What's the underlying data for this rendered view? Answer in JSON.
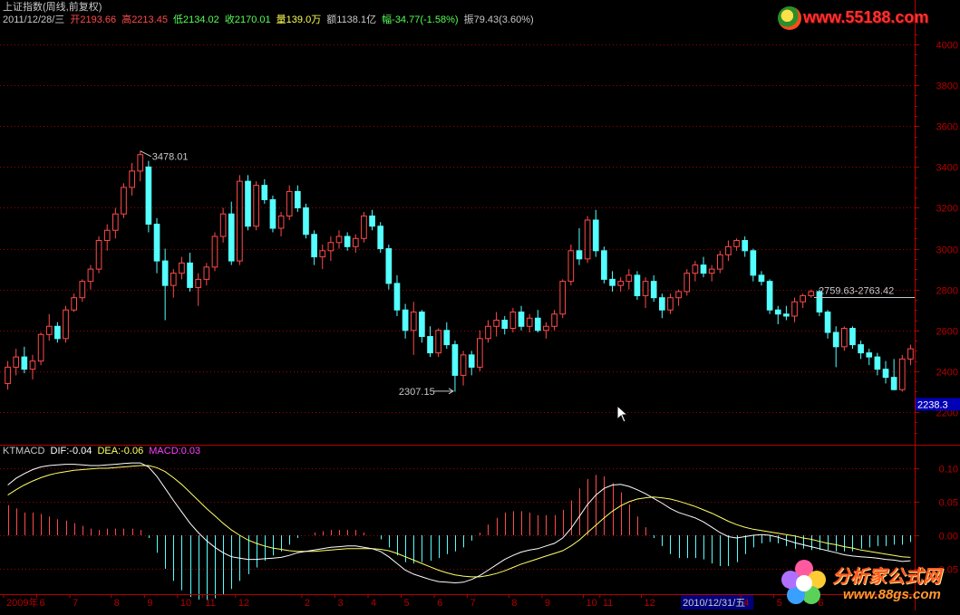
{
  "colors": {
    "background": "#000000",
    "axis": "#b40000",
    "grid": "#a00000",
    "up": "#ff4a4a",
    "down": "#54ffff",
    "label_white": "#c8c8c8",
    "dif_line": "#ffffff",
    "dea_line": "#ffff66",
    "macd_label": "#ff40ff",
    "last_price_bg": "#0000b4",
    "date_highlight_bg": "#00007a"
  },
  "header": {
    "title": "上证指数(周线,前复权)",
    "date": "2011/12/28/三",
    "open_label": "开",
    "open": "2193.66",
    "high_label": "高",
    "high": "2213.45",
    "low_label": "低",
    "low": "2134.02",
    "close_label": "收",
    "close": "2170.01",
    "volume_label": "量",
    "volume": "139.0万",
    "amount_label": "额",
    "amount": "1138.1亿",
    "change_label": "幅",
    "change": "-34.77(-1.58%)",
    "amplitude_label": "振",
    "amplitude": "79.43(3.60%)"
  },
  "macd_header": {
    "name": "KTMACD",
    "dif_label": "DIF:",
    "dif": "-0.04",
    "dea_label": "DEA:",
    "dea": "-0.06",
    "macd_label": "MACD:",
    "macd": "0.03"
  },
  "watermarks": {
    "top_url": "www.55188.com",
    "bottom_name": "分析家公式网",
    "bottom_url": "www.88gs.com"
  },
  "chart_data": [
    {
      "type": "candlestick",
      "title": "上证指数(周线,前复权)",
      "yticks": [
        "4000",
        "3800",
        "3600",
        "3400",
        "3200",
        "3000",
        "2800",
        "2600",
        "2400",
        "2200"
      ],
      "ylim": [
        2100,
        4050
      ],
      "last_price": "2238.3",
      "annotations": {
        "high": "3478.01",
        "low": "2307.15",
        "range_label": "2759.63-2763.42",
        "range_value": 2761
      },
      "candles": [
        [
          2340,
          2450,
          2310,
          2420
        ],
        [
          2420,
          2510,
          2380,
          2470
        ],
        [
          2470,
          2520,
          2390,
          2410
        ],
        [
          2410,
          2480,
          2360,
          2450
        ],
        [
          2450,
          2590,
          2430,
          2580
        ],
        [
          2580,
          2680,
          2550,
          2620
        ],
        [
          2620,
          2640,
          2540,
          2560
        ],
        [
          2560,
          2720,
          2540,
          2700
        ],
        [
          2700,
          2780,
          2690,
          2760
        ],
        [
          2760,
          2850,
          2740,
          2840
        ],
        [
          2840,
          2920,
          2800,
          2900
        ],
        [
          2900,
          3060,
          2880,
          3040
        ],
        [
          3040,
          3120,
          2990,
          3090
        ],
        [
          3090,
          3200,
          3050,
          3170
        ],
        [
          3170,
          3320,
          3150,
          3300
        ],
        [
          3300,
          3420,
          3260,
          3380
        ],
        [
          3380,
          3478,
          3330,
          3460
        ],
        [
          3400,
          3430,
          3080,
          3120
        ],
        [
          3120,
          3150,
          2880,
          2940
        ],
        [
          2940,
          3000,
          2650,
          2820
        ],
        [
          2820,
          2900,
          2760,
          2880
        ],
        [
          2880,
          2960,
          2850,
          2930
        ],
        [
          2930,
          2980,
          2790,
          2810
        ],
        [
          2810,
          2880,
          2720,
          2850
        ],
        [
          2850,
          2930,
          2820,
          2910
        ],
        [
          2910,
          3080,
          2890,
          3060
        ],
        [
          3060,
          3200,
          3030,
          3170
        ],
        [
          3170,
          3230,
          2920,
          2940
        ],
        [
          2940,
          3360,
          2920,
          3330
        ],
        [
          3330,
          3360,
          3090,
          3110
        ],
        [
          3110,
          3330,
          3090,
          3310
        ],
        [
          3310,
          3340,
          3220,
          3240
        ],
        [
          3240,
          3260,
          3080,
          3100
        ],
        [
          3100,
          3180,
          3060,
          3160
        ],
        [
          3160,
          3310,
          3140,
          3280
        ],
        [
          3280,
          3310,
          3180,
          3200
        ],
        [
          3200,
          3220,
          3050,
          3070
        ],
        [
          3070,
          3090,
          2920,
          2960
        ],
        [
          2960,
          3020,
          2900,
          2990
        ],
        [
          2990,
          3060,
          2940,
          3030
        ],
        [
          3030,
          3090,
          3000,
          3060
        ],
        [
          3060,
          3080,
          2990,
          3010
        ],
        [
          3010,
          3070,
          2980,
          3050
        ],
        [
          3050,
          3180,
          3030,
          3160
        ],
        [
          3160,
          3190,
          3090,
          3110
        ],
        [
          3110,
          3130,
          2980,
          3000
        ],
        [
          3000,
          3020,
          2800,
          2830
        ],
        [
          2830,
          2870,
          2670,
          2700
        ],
        [
          2700,
          2730,
          2560,
          2600
        ],
        [
          2600,
          2740,
          2480,
          2690
        ],
        [
          2690,
          2700,
          2540,
          2570
        ],
        [
          2570,
          2620,
          2470,
          2490
        ],
        [
          2490,
          2610,
          2470,
          2600
        ],
        [
          2600,
          2640,
          2510,
          2530
        ],
        [
          2530,
          2550,
          2300,
          2380
        ],
        [
          2380,
          2500,
          2330,
          2480
        ],
        [
          2480,
          2500,
          2380,
          2420
        ],
        [
          2420,
          2600,
          2400,
          2560
        ],
        [
          2560,
          2650,
          2540,
          2620
        ],
        [
          2620,
          2690,
          2570,
          2650
        ],
        [
          2650,
          2670,
          2580,
          2610
        ],
        [
          2610,
          2710,
          2590,
          2690
        ],
        [
          2690,
          2720,
          2600,
          2620
        ],
        [
          2620,
          2680,
          2590,
          2660
        ],
        [
          2660,
          2700,
          2590,
          2600
        ],
        [
          2600,
          2640,
          2560,
          2620
        ],
        [
          2620,
          2700,
          2600,
          2680
        ],
        [
          2680,
          2850,
          2660,
          2840
        ],
        [
          2840,
          3020,
          2820,
          2990
        ],
        [
          2990,
          3100,
          2920,
          2950
        ],
        [
          2950,
          3160,
          2930,
          3140
        ],
        [
          3140,
          3190,
          2960,
          2990
        ],
        [
          2990,
          3010,
          2830,
          2850
        ],
        [
          2850,
          2890,
          2790,
          2820
        ],
        [
          2820,
          2860,
          2790,
          2840
        ],
        [
          2840,
          2900,
          2800,
          2870
        ],
        [
          2870,
          2890,
          2750,
          2770
        ],
        [
          2770,
          2860,
          2710,
          2840
        ],
        [
          2840,
          2870,
          2740,
          2760
        ],
        [
          2760,
          2780,
          2660,
          2700
        ],
        [
          2700,
          2780,
          2680,
          2760
        ],
        [
          2760,
          2800,
          2720,
          2790
        ],
        [
          2790,
          2900,
          2770,
          2880
        ],
        [
          2880,
          2940,
          2840,
          2920
        ],
        [
          2920,
          2960,
          2860,
          2880
        ],
        [
          2880,
          2920,
          2840,
          2900
        ],
        [
          2900,
          2990,
          2880,
          2970
        ],
        [
          2970,
          3040,
          2940,
          3010
        ],
        [
          3010,
          3050,
          2990,
          3040
        ],
        [
          3040,
          3060,
          2960,
          2990
        ],
        [
          2990,
          3000,
          2840,
          2870
        ],
        [
          2870,
          2890,
          2820,
          2840
        ],
        [
          2840,
          2850,
          2680,
          2700
        ],
        [
          2700,
          2720,
          2630,
          2680
        ],
        [
          2680,
          2720,
          2650,
          2670
        ],
        [
          2670,
          2760,
          2640,
          2740
        ],
        [
          2740,
          2780,
          2710,
          2770
        ],
        [
          2770,
          2800,
          2760,
          2790
        ],
        [
          2790,
          2800,
          2670,
          2690
        ],
        [
          2690,
          2700,
          2560,
          2590
        ],
        [
          2590,
          2620,
          2420,
          2520
        ],
        [
          2520,
          2620,
          2500,
          2610
        ],
        [
          2610,
          2620,
          2510,
          2530
        ],
        [
          2530,
          2550,
          2460,
          2490
        ],
        [
          2490,
          2510,
          2430,
          2470
        ],
        [
          2470,
          2490,
          2380,
          2410
        ],
        [
          2410,
          2450,
          2340,
          2370
        ],
        [
          2370,
          2460,
          2307,
          2310
        ],
        [
          2310,
          2480,
          2300,
          2460
        ],
        [
          2460,
          2530,
          2430,
          2510
        ]
      ]
    },
    {
      "type": "macd",
      "yticks": [
        "0.10",
        "0.05",
        "0.00",
        "-0.05"
      ],
      "ylim": [
        -0.11,
        0.13
      ],
      "dif": [
        0.075,
        0.085,
        0.092,
        0.098,
        0.102,
        0.104,
        0.105,
        0.106,
        0.106,
        0.105,
        0.104,
        0.104,
        0.105,
        0.106,
        0.107,
        0.108,
        0.108,
        0.102,
        0.088,
        0.07,
        0.052,
        0.035,
        0.018,
        0.004,
        -0.008,
        -0.018,
        -0.026,
        -0.032,
        -0.034,
        -0.036,
        -0.036,
        -0.035,
        -0.034,
        -0.033,
        -0.03,
        -0.026,
        -0.024,
        -0.022,
        -0.02,
        -0.018,
        -0.017,
        -0.016,
        -0.016,
        -0.018,
        -0.02,
        -0.024,
        -0.032,
        -0.042,
        -0.052,
        -0.058,
        -0.062,
        -0.066,
        -0.069,
        -0.07,
        -0.071,
        -0.07,
        -0.066,
        -0.06,
        -0.052,
        -0.044,
        -0.036,
        -0.03,
        -0.025,
        -0.022,
        -0.02,
        -0.016,
        -0.012,
        -0.004,
        0.01,
        0.028,
        0.046,
        0.06,
        0.07,
        0.075,
        0.076,
        0.073,
        0.068,
        0.062,
        0.055,
        0.048,
        0.04,
        0.034,
        0.03,
        0.026,
        0.02,
        0.012,
        0.004,
        -0.002,
        -0.004,
        -0.002,
        0.0,
        0.001,
        0.0,
        -0.003,
        -0.007,
        -0.011,
        -0.014,
        -0.017,
        -0.02,
        -0.023,
        -0.026,
        -0.029,
        -0.031,
        -0.032,
        -0.033,
        -0.034,
        -0.036,
        -0.037,
        -0.039,
        -0.038
      ],
      "dea": [
        0.06,
        0.068,
        0.075,
        0.081,
        0.086,
        0.09,
        0.093,
        0.095,
        0.097,
        0.098,
        0.099,
        0.1,
        0.1,
        0.101,
        0.102,
        0.103,
        0.104,
        0.104,
        0.101,
        0.095,
        0.086,
        0.076,
        0.064,
        0.052,
        0.04,
        0.029,
        0.018,
        0.008,
        0.0,
        -0.007,
        -0.012,
        -0.016,
        -0.019,
        -0.021,
        -0.023,
        -0.024,
        -0.024,
        -0.024,
        -0.023,
        -0.022,
        -0.021,
        -0.02,
        -0.02,
        -0.02,
        -0.02,
        -0.021,
        -0.023,
        -0.027,
        -0.032,
        -0.037,
        -0.042,
        -0.047,
        -0.052,
        -0.056,
        -0.059,
        -0.061,
        -0.062,
        -0.062,
        -0.06,
        -0.057,
        -0.053,
        -0.048,
        -0.043,
        -0.039,
        -0.035,
        -0.031,
        -0.027,
        -0.023,
        -0.016,
        -0.007,
        0.004,
        0.015,
        0.026,
        0.036,
        0.044,
        0.05,
        0.054,
        0.056,
        0.057,
        0.056,
        0.054,
        0.051,
        0.047,
        0.043,
        0.038,
        0.033,
        0.027,
        0.021,
        0.016,
        0.012,
        0.009,
        0.007,
        0.005,
        0.003,
        0.001,
        -0.001,
        -0.004,
        -0.006,
        -0.009,
        -0.012,
        -0.014,
        -0.017,
        -0.019,
        -0.022,
        -0.024,
        -0.026,
        -0.028,
        -0.03,
        -0.032,
        -0.033
      ],
      "macd": [
        0.045,
        0.04,
        0.034,
        0.034,
        0.032,
        0.028,
        0.024,
        0.022,
        0.018,
        0.014,
        0.01,
        0.008,
        0.01,
        0.01,
        0.01,
        0.01,
        0.008,
        -0.004,
        -0.026,
        -0.05,
        -0.068,
        -0.082,
        -0.092,
        -0.096,
        -0.096,
        -0.094,
        -0.088,
        -0.08,
        -0.068,
        -0.058,
        -0.048,
        -0.038,
        -0.03,
        -0.024,
        -0.014,
        -0.004,
        0.0,
        0.004,
        0.006,
        0.008,
        0.008,
        0.008,
        0.008,
        0.004,
        0.0,
        -0.006,
        -0.018,
        -0.03,
        -0.04,
        -0.042,
        -0.04,
        -0.038,
        -0.034,
        -0.028,
        -0.024,
        -0.018,
        -0.008,
        0.004,
        0.016,
        0.026,
        0.034,
        0.036,
        0.036,
        0.034,
        0.03,
        0.03,
        0.03,
        0.038,
        0.052,
        0.07,
        0.084,
        0.09,
        0.088,
        0.078,
        0.064,
        0.046,
        0.028,
        0.012,
        -0.004,
        -0.016,
        -0.028,
        -0.034,
        -0.034,
        -0.034,
        -0.036,
        -0.042,
        -0.046,
        -0.046,
        -0.04,
        -0.028,
        -0.018,
        -0.012,
        -0.01,
        -0.012,
        -0.016,
        -0.02,
        -0.02,
        -0.022,
        -0.022,
        -0.022,
        -0.024,
        -0.024,
        -0.024,
        -0.02,
        -0.018,
        -0.016,
        -0.016,
        -0.014,
        -0.014,
        -0.01
      ]
    }
  ],
  "x_axis": {
    "labels": [
      {
        "text": "2009年",
        "i": 0
      },
      {
        "text": "6",
        "i": 4
      },
      {
        "text": "7",
        "i": 8
      },
      {
        "text": "8",
        "i": 13
      },
      {
        "text": "9",
        "i": 17
      },
      {
        "text": "10",
        "i": 21
      },
      {
        "text": "11",
        "i": 24
      },
      {
        "text": "12",
        "i": 28
      },
      {
        "text": "2",
        "i": 36
      },
      {
        "text": "3",
        "i": 40
      },
      {
        "text": "4",
        "i": 44
      },
      {
        "text": "5",
        "i": 48
      },
      {
        "text": "6",
        "i": 52
      },
      {
        "text": "7",
        "i": 56
      },
      {
        "text": "8",
        "i": 61
      },
      {
        "text": "9",
        "i": 65
      },
      {
        "text": "10",
        "i": 70
      },
      {
        "text": "11",
        "i": 72
      },
      {
        "text": "12",
        "i": 77
      },
      {
        "text": "2010/12/31/五",
        "i": 82,
        "highlight": true
      },
      {
        "text": "4",
        "i": 89
      },
      {
        "text": "5",
        "i": 93
      },
      {
        "text": "6",
        "i": 98
      }
    ]
  }
}
